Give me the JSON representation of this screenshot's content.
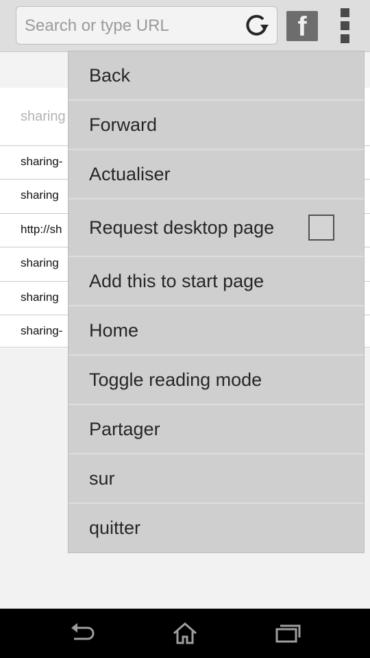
{
  "toolbar": {
    "url_placeholder": "Search or type URL",
    "facebook_label": "f"
  },
  "page": {
    "rows": [
      "sharing",
      "sharing-",
      "sharing",
      "http://sh",
      "sharing",
      "sharing",
      "sharing-"
    ]
  },
  "menu": {
    "items": [
      {
        "label": "Back"
      },
      {
        "label": "Forward"
      },
      {
        "label": "Actualiser"
      },
      {
        "label": "Request desktop page",
        "checked": false
      },
      {
        "label": "Add this to start page"
      },
      {
        "label": "Home"
      },
      {
        "label": "Toggle reading mode"
      },
      {
        "label": "Partager"
      },
      {
        "label": "sur"
      },
      {
        "label": "quitter"
      }
    ]
  },
  "navbar": {
    "icons": [
      "back-icon",
      "home-icon",
      "recent-apps-icon"
    ]
  },
  "colors": {
    "toolbar_bg": "#dedede",
    "menu_bg": "#cfcfcf",
    "navbar_bg": "#000000"
  }
}
